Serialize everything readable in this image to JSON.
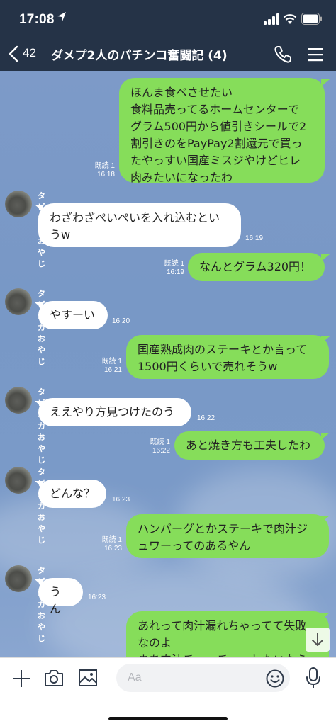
{
  "status_bar": {
    "time": "17:08"
  },
  "header": {
    "back_count": "42",
    "title": "ダメプ2人のパチンコ奮闘記 (4)"
  },
  "messages": [
    {
      "side": "sent",
      "text": "ほんま食べさせたい\n食料品売ってるホームセンターで\nグラム500円から値引きシールで2\n割引きのをPayPay2割還元で買っ\nたやっすい国産ミスジやけどヒレ\n肉みたいになったわ",
      "read": "既読 1",
      "time": "16:18"
    },
    {
      "side": "recv",
      "sender": "タピオカおやじ",
      "text": "わざわざぺいぺいを入れ込むとい\nうw",
      "time": "16:19"
    },
    {
      "side": "sent",
      "text": "なんとグラム320円！",
      "read": "既読 1",
      "time": "16:19"
    },
    {
      "side": "recv",
      "sender": "タピオカおやじ",
      "text": "やすーい",
      "time": "16:20"
    },
    {
      "side": "sent",
      "text": "国産熟成肉のステーキとか言って\n1500円くらいで売れそうw",
      "read": "既読 1",
      "time": "16:21"
    },
    {
      "side": "recv",
      "sender": "タピオカおやじ",
      "text": "ええやり方見つけたのう",
      "time": "16:22"
    },
    {
      "side": "sent",
      "text": "あと焼き方も工夫したわ",
      "read": "既読 1",
      "time": "16:22"
    },
    {
      "side": "recv",
      "sender": "タピオカおやじ",
      "text": "どんな？",
      "time": "16:23"
    },
    {
      "side": "sent",
      "text": "ハンバーグとかステーキで肉汁ジ\nュワーってのあるやん",
      "read": "既読 1",
      "time": "16:23"
    },
    {
      "side": "recv",
      "sender": "タピオカおやじ",
      "text": "うん",
      "time": "16:23"
    },
    {
      "side": "sent",
      "text": "あれって肉汁漏れちゃってて失敗\nなのよ\nまあ肉汁チューチューしたいなら",
      "read": "",
      "time": ""
    }
  ],
  "input": {
    "placeholder": "Aa"
  },
  "icons": {
    "back": "chevron-left-icon",
    "call": "phone-icon",
    "menu": "hamburger-menu-icon",
    "plus": "plus-icon",
    "camera": "camera-icon",
    "image": "image-icon",
    "emoji": "emoji-icon",
    "mic": "microphone-icon",
    "scroll": "arrow-down-icon"
  },
  "colors": {
    "header_bg": "#253347",
    "chat_bg": "#7d9ac8",
    "sent_bubble": "#86dd5a",
    "recv_bubble": "#ffffff"
  }
}
